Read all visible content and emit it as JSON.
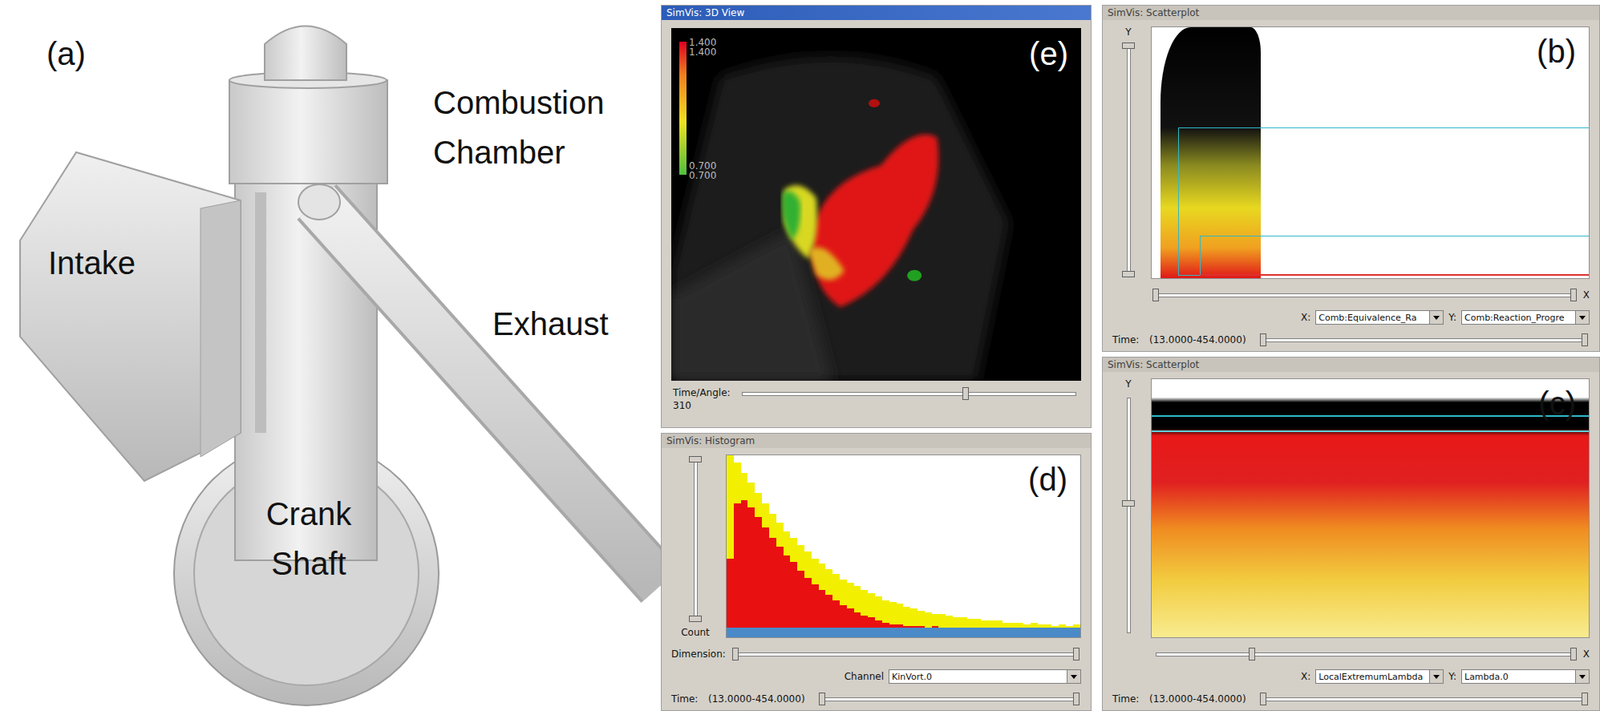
{
  "figure": {
    "label": "(a)",
    "parts": [
      {
        "lines": [
          "Combustion",
          "Chamber"
        ]
      },
      {
        "lines": [
          "Intake"
        ]
      },
      {
        "lines": [
          "Exhaust"
        ]
      },
      {
        "lines": [
          "Crank",
          "Shaft"
        ]
      }
    ]
  },
  "view3d": {
    "title": "SimVis: 3D View",
    "active": true,
    "panel_label": "(e)",
    "colorbar": {
      "max": [
        "1.400",
        "1.400"
      ],
      "min": [
        "0.700",
        "0.700"
      ]
    },
    "time_slider": {
      "label": "Time/Angle:",
      "value": "310",
      "level": 0.67
    }
  },
  "histogram": {
    "title": "SimVis: Histogram",
    "active": false,
    "panel_label": "(d)",
    "y_label": "Count",
    "y_slider": {
      "low": 0,
      "high": 1
    },
    "dimension": {
      "label": "Dimension:",
      "low": 0,
      "high": 1
    },
    "channel": {
      "label": "Channel",
      "value": "KinVort.0"
    },
    "time": {
      "label": "Time:",
      "range": "(13.0000-454.0000)",
      "low": 0,
      "high": 1
    },
    "series": [
      {
        "color": "#f2f000",
        "values": [
          100,
          96,
          90,
          84,
          78,
          72,
          66,
          61,
          56,
          52,
          48,
          44,
          40,
          37,
          34,
          31,
          28,
          26,
          24,
          22,
          20,
          18,
          16,
          15,
          14,
          12,
          11,
          10,
          9,
          8,
          8,
          7,
          6,
          6,
          5,
          5,
          4,
          4,
          4,
          3,
          3,
          3,
          2,
          3,
          2,
          2,
          1,
          2,
          1,
          2
        ]
      },
      {
        "color": "#e81010",
        "values": [
          40,
          72,
          74,
          70,
          64,
          58,
          52,
          47,
          42,
          38,
          33,
          29,
          25,
          22,
          19,
          16,
          13,
          11,
          9,
          7,
          6,
          4,
          3,
          2,
          2,
          1,
          1,
          1,
          0,
          1,
          0,
          0,
          0,
          0,
          0,
          0,
          0,
          0,
          0,
          0,
          0,
          0,
          0,
          0,
          0,
          0,
          0,
          0,
          0,
          0
        ]
      }
    ]
  },
  "scatterplots": [
    {
      "title": "SimVis: Scatterplot",
      "active": false,
      "panel_label": "(b)",
      "y_label": "Y",
      "x_label": "X",
      "y_slider": {
        "low": 0,
        "high": 1
      },
      "x_slider": {
        "low": 0,
        "high": 1
      },
      "x_axis": {
        "label": "X:",
        "value": "Comb:Equivalence_Ra"
      },
      "y_axis": {
        "label": "Y:",
        "value": "Comb:Reaction_Progre"
      },
      "time": {
        "label": "Time:",
        "range": "(13.0000-454.0000)",
        "low": 0,
        "high": 1
      }
    },
    {
      "title": "SimVis: Scatterplot",
      "active": false,
      "panel_label": "(c)",
      "y_label": "Y",
      "x_label": "X",
      "y_slider": {
        "low": 0.55,
        "high": 0.55
      },
      "x_slider": {
        "low": 0.23,
        "high": 1
      },
      "x_axis": {
        "label": "X:",
        "value": "LocalExtremumLambda"
      },
      "y_axis": {
        "label": "Y:",
        "value": "Lambda.0"
      },
      "time": {
        "label": "Time:",
        "range": "(13.0000-454.0000)",
        "low": 0,
        "high": 1
      }
    }
  ]
}
